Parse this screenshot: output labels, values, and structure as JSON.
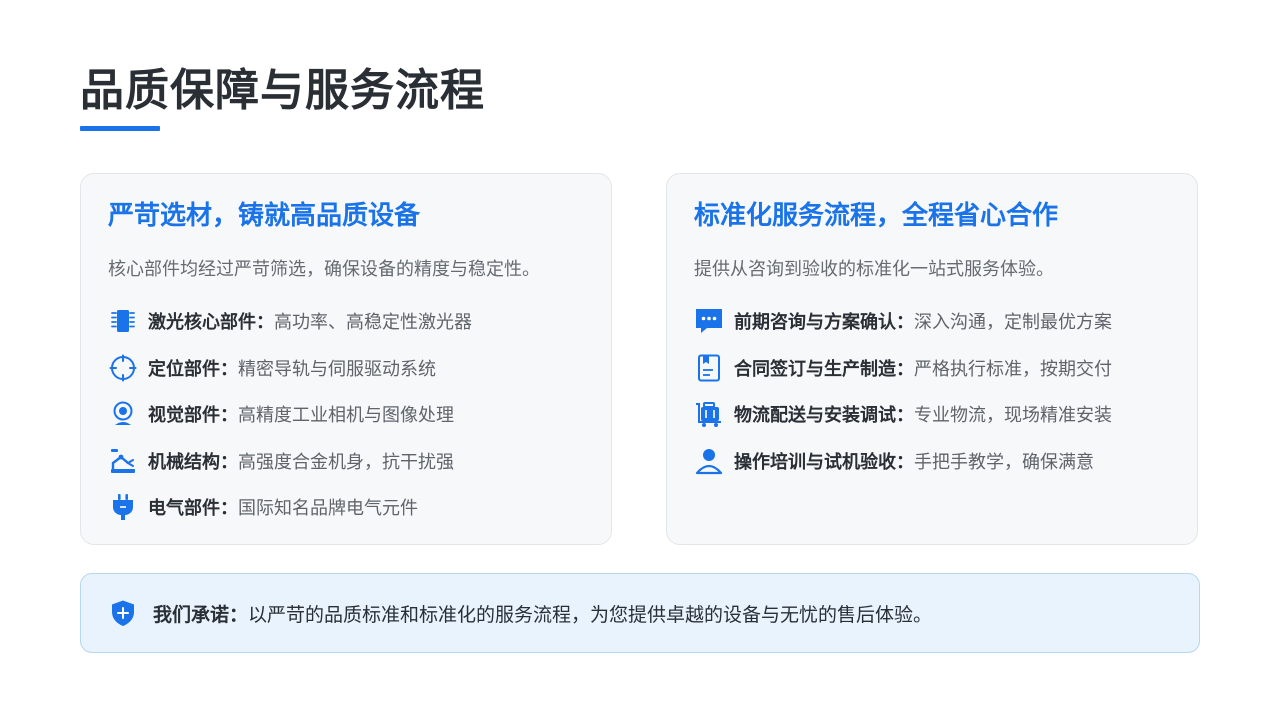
{
  "page": {
    "title": "品质保障与服务流程"
  },
  "quality_card": {
    "title": "严苛选材，铸就高品质设备",
    "description": "核心部件均经过严苛筛选，确保设备的精度与稳定性。",
    "items": [
      {
        "icon": "chip-icon",
        "label": "激光核心部件",
        "text": "高功率、高稳定性激光器"
      },
      {
        "icon": "crosshair-icon",
        "label": "定位部件",
        "text": "精密导轨与伺服驱动系统"
      },
      {
        "icon": "camera-icon",
        "label": "视觉部件",
        "text": "高精度工业相机与图像处理"
      },
      {
        "icon": "robot-arm-icon",
        "label": "机械结构",
        "text": "高强度合金机身，抗干扰强"
      },
      {
        "icon": "plug-icon",
        "label": "电气部件",
        "text": "国际知名品牌电气元件"
      }
    ]
  },
  "service_card": {
    "title": "标准化服务流程，全程省心合作",
    "description": "提供从咨询到验收的标准化一站式服务体验。",
    "items": [
      {
        "icon": "chat-icon",
        "label": "前期咨询与方案确认",
        "text": "深入沟通，定制最优方案"
      },
      {
        "icon": "contract-icon",
        "label": "合同签订与生产制造",
        "text": "严格执行标准，按期交付"
      },
      {
        "icon": "truck-icon",
        "label": "物流配送与安装调试",
        "text": "专业物流，现场精准安装"
      },
      {
        "icon": "user-icon",
        "label": "操作培训与试机验收",
        "text": "手把手教学，确保满意"
      }
    ]
  },
  "promise": {
    "icon": "shield-plus-icon",
    "label": "我们承诺：",
    "text": "以严苛的品质标准和标准化的服务流程，为您提供卓越的设备与无忧的售后体验。"
  },
  "colors": {
    "accent": "#1a73e8",
    "text": "#2a2f36",
    "muted": "#666b72",
    "card_bg": "#f6f8fa",
    "promise_bg": "#e8f3fd"
  }
}
